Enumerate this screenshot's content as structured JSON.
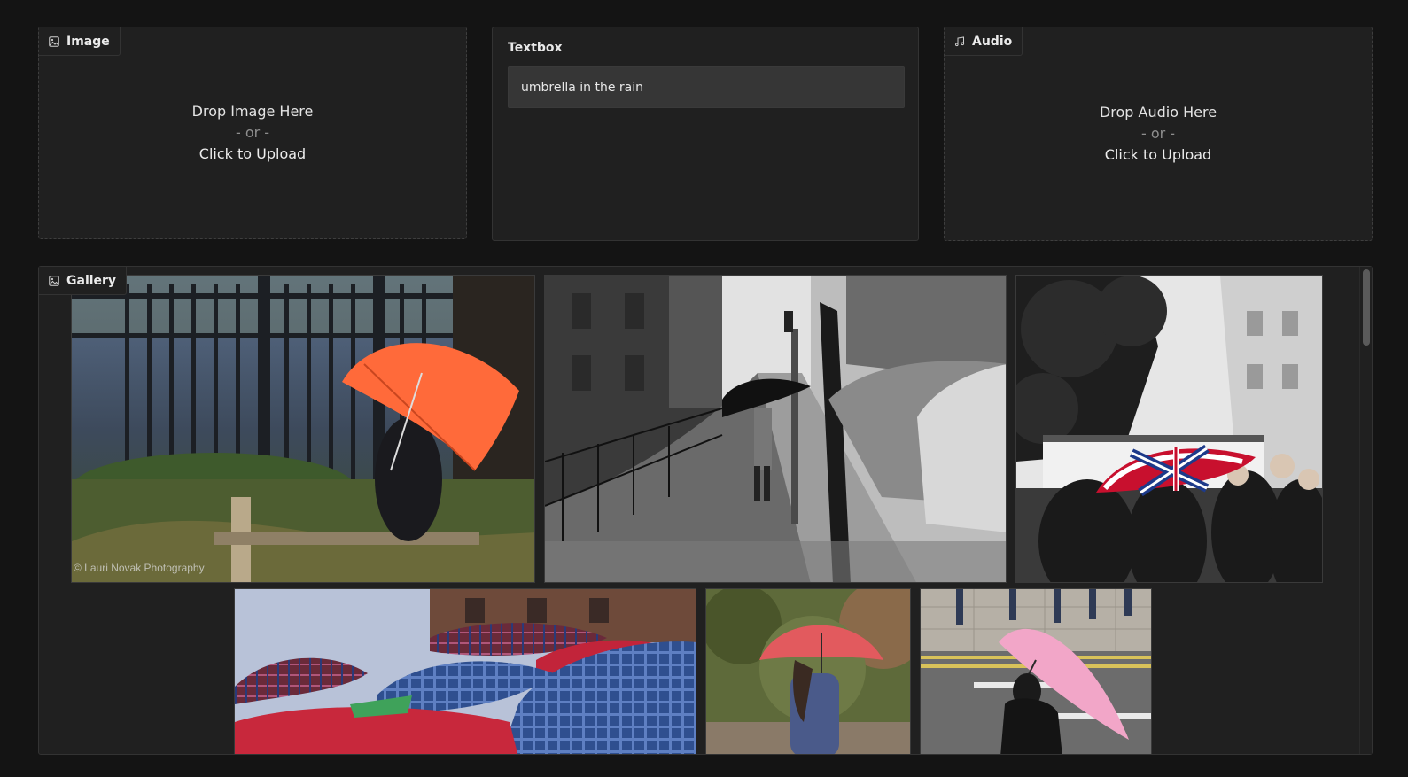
{
  "image_panel": {
    "label": "Image",
    "icon": "image-icon",
    "drop_text": "Drop Image Here",
    "or_text": "- or -",
    "click_text": "Click to Upload"
  },
  "textbox_panel": {
    "label": "Textbox",
    "value": "umbrella in the rain"
  },
  "audio_panel": {
    "label": "Audio",
    "icon": "music-note-icon",
    "drop_text": "Drop Audio Here",
    "or_text": "- or -",
    "click_text": "Click to Upload"
  },
  "gallery": {
    "label": "Gallery",
    "icon": "image-icon",
    "watermark": "© Lauri Novak Photography",
    "items": [
      {
        "name": "orange-umbrella-by-fence"
      },
      {
        "name": "black-umbrella-wet-sidewalk"
      },
      {
        "name": "union-jack-umbrella-crowd"
      },
      {
        "name": "plaid-umbrellas-crowd"
      },
      {
        "name": "red-umbrella-woman-back"
      },
      {
        "name": "pink-umbrella-street"
      }
    ]
  },
  "colors": {
    "background": "#141414",
    "panel": "#202020",
    "input": "#363636",
    "orange_umbrella": "#ff6a3a",
    "red_umbrella": "#e25a5e",
    "pink_umbrella": "#f2a6c8"
  }
}
